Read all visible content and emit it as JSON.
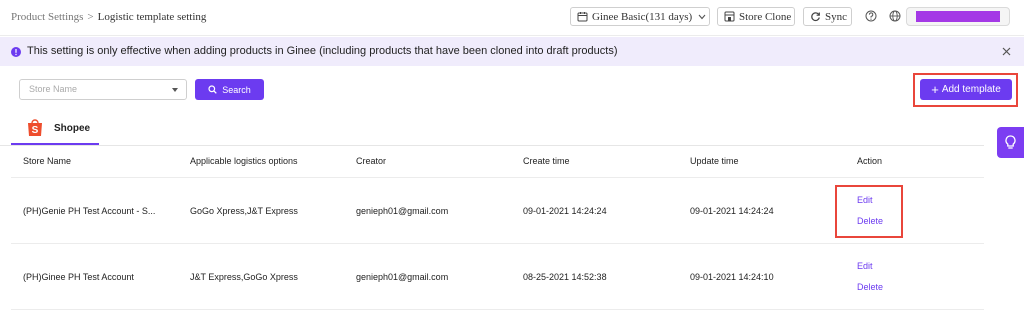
{
  "breadcrumb": {
    "parent": "Product Settings",
    "separator": ">",
    "current": "Logistic template setting"
  },
  "header": {
    "plan_label": "Ginee Basic(131 days)",
    "store_clone_label": "Store Clone",
    "sync_label": "Sync",
    "icons": [
      "calendar-icon",
      "store-icon",
      "sync-icon",
      "help-icon",
      "globe-icon"
    ]
  },
  "notice": {
    "text": "This setting is only effective when adding products in Ginee (including products that have been cloned into draft products)"
  },
  "filter": {
    "store_placeholder": "Store Name",
    "search_label": "Search",
    "add_label": "Add template"
  },
  "tabs": [
    {
      "label": "Shopee",
      "active": true
    }
  ],
  "table": {
    "columns": [
      "Store Name",
      "Applicable logistics options",
      "Creator",
      "Create time",
      "Update time",
      "Action"
    ],
    "rows": [
      {
        "store": "(PH)Genie PH Test Account - S...",
        "logistics": "GoGo Xpress,J&T Express",
        "creator": "genieph01@gmail.com",
        "create_time": "09-01-2021 14:24:24",
        "update_time": "09-01-2021 14:24:24",
        "edit": "Edit",
        "delete": "Delete"
      },
      {
        "store": "(PH)Ginee PH Test Account",
        "logistics": "J&T Express,GoGo Xpress",
        "creator": "genieph01@gmail.com",
        "create_time": "08-25-2021 14:52:38",
        "update_time": "09-01-2021 14:24:10",
        "edit": "Edit",
        "delete": "Delete"
      }
    ]
  },
  "colors": {
    "accent": "#6c3bf0",
    "highlight": "#e9463b",
    "notice_bg": "#f0ecfc",
    "shopee": "#ee4d2d",
    "redacted": "#a439e6"
  }
}
